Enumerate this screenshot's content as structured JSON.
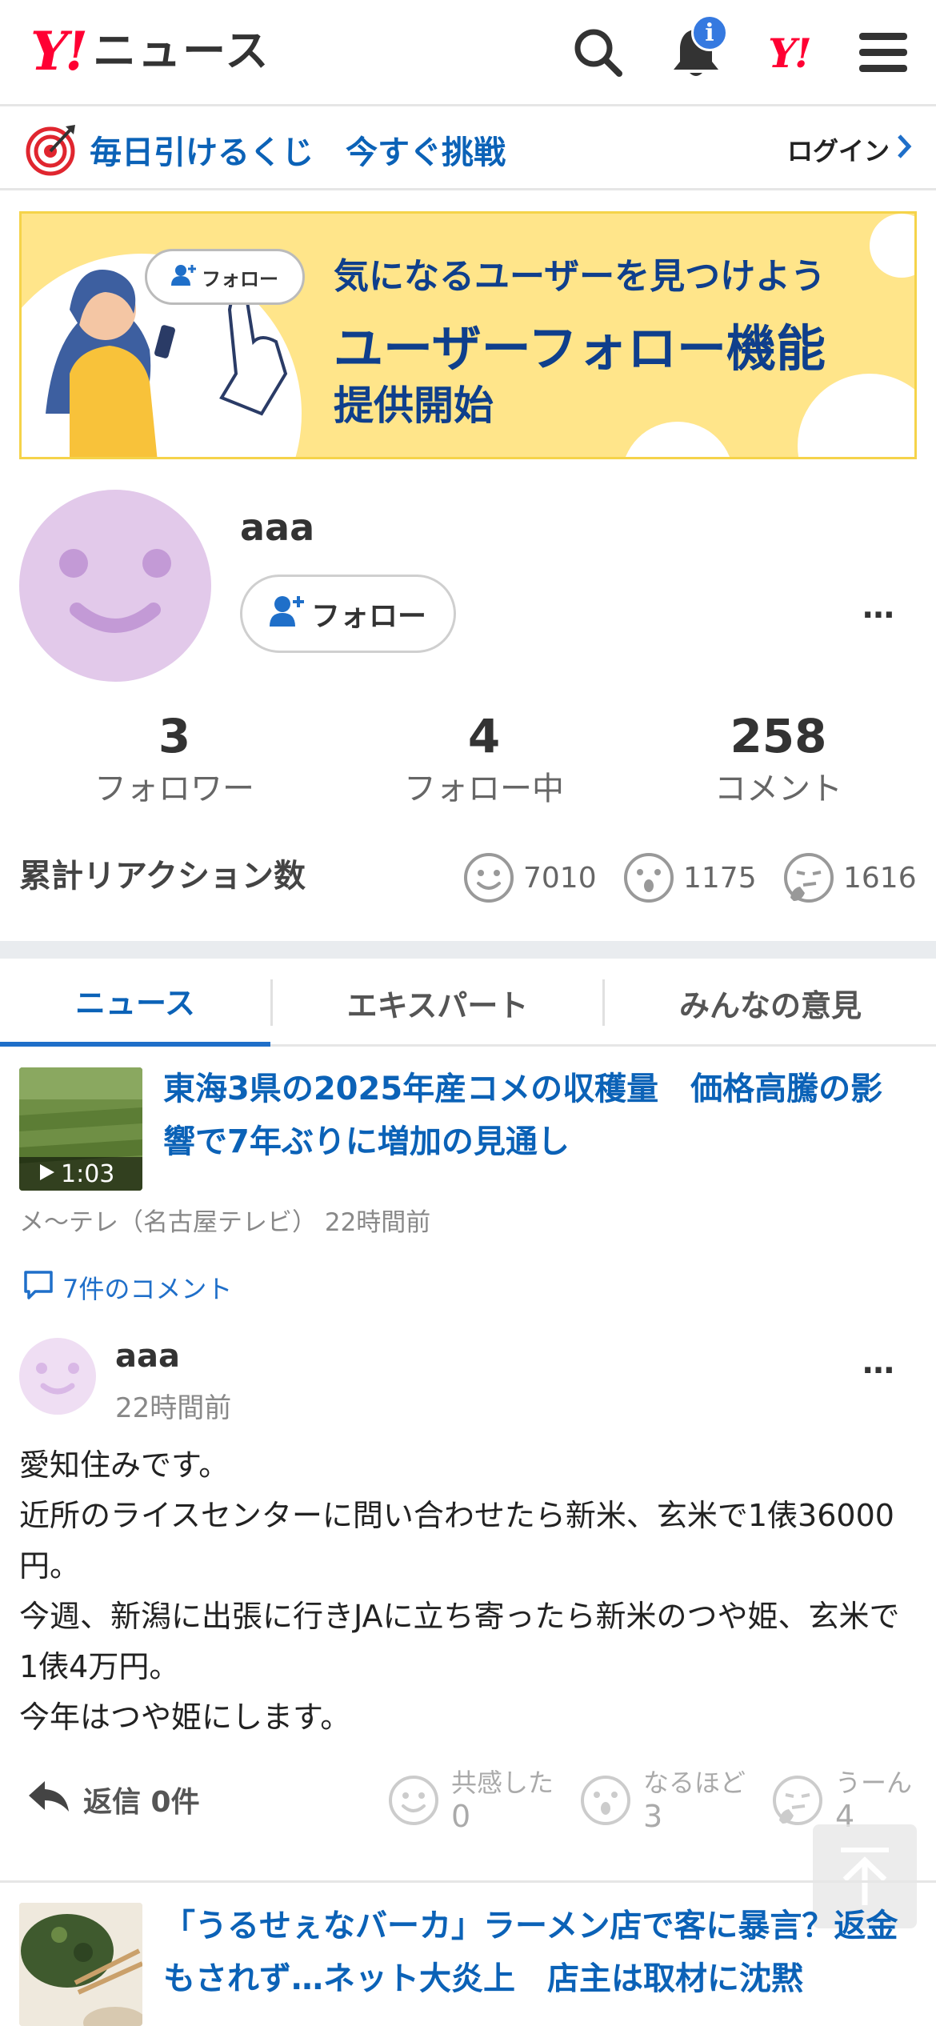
{
  "header": {
    "logo_mark": "Y!",
    "logo_text": "ニュース",
    "notification_badge": "i",
    "yj_mark": "Y!"
  },
  "lottery": {
    "text": "毎日引けるくじ　今すぐ挑戦",
    "login_label": "ログイン"
  },
  "banner": {
    "chip_label": "フォロー",
    "line1": "気になるユーザーを見つけよう",
    "line2": "ユーザーフォロー機能",
    "line3": "提供開始"
  },
  "profile": {
    "username": "aaa",
    "follow_label": "フォロー",
    "more": "…",
    "stats": [
      {
        "value": "3",
        "label": "フォロワー"
      },
      {
        "value": "4",
        "label": "フォロー中"
      },
      {
        "value": "258",
        "label": "コメント"
      }
    ],
    "reaction_title": "累計リアクション数",
    "reactions": [
      {
        "icon": "smile-icon",
        "value": "7010"
      },
      {
        "icon": "surprised-icon",
        "value": "1175"
      },
      {
        "icon": "thinking-icon",
        "value": "1616"
      }
    ]
  },
  "tabs": [
    {
      "label": "ニュース",
      "active": true
    },
    {
      "label": "エキスパート",
      "active": false
    },
    {
      "label": "みんなの意見",
      "active": false
    }
  ],
  "article": {
    "duration": "1:03",
    "title": "東海3県の2025年産コメの収穫量　価格高騰の影響で7年ぶりに増加の見通し",
    "source": "メ〜テレ（名古屋テレビ）  22時間前",
    "comment_count": "7件のコメント"
  },
  "comment": {
    "user": "aaa",
    "time": "22時間前",
    "more": "…",
    "body_lines": [
      "愛知住みです。",
      "近所のライスセンターに問い合わせたら新米、玄米で1俵36000円。",
      "今週、新潟に出張に行きJAに立ち寄ったら新米のつや姫、玄米で1俵4万円。",
      "今年はつや姫にします。"
    ],
    "reply_label": "返信 0件",
    "reactions": [
      {
        "icon": "smile-icon",
        "label": "共感した",
        "value": "0"
      },
      {
        "icon": "surprised-icon",
        "label": "なるほど",
        "value": "3"
      },
      {
        "icon": "thinking-icon",
        "label": "うーん",
        "value": "4"
      }
    ]
  },
  "article2": {
    "title": "「うるせぇなバーカ」ラーメン店で客に暴言？返金もされず…ネット大炎上　店主は取材に沈黙"
  },
  "colors": {
    "brand_red": "#ff0033",
    "link_blue": "#0b62b7",
    "accent_blue": "#1f6fc9"
  }
}
